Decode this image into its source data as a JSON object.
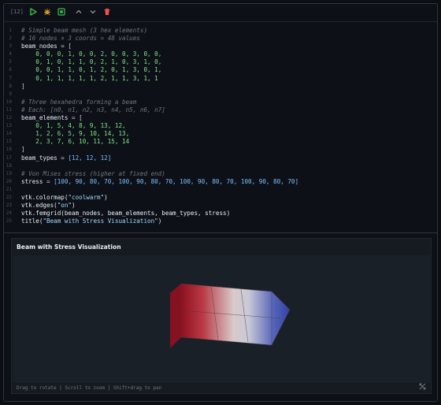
{
  "cell": {
    "execution_count": "[12]",
    "toolbar": {
      "run_icon": "play-icon",
      "debug_icon": "bug-icon",
      "save_icon": "save-icon",
      "move_up_icon": "chevron-up-icon",
      "move_down_icon": "chevron-down-icon",
      "delete_icon": "trash-icon"
    },
    "code_lines": [
      {
        "n": "1",
        "tokens": [
          {
            "t": "comment",
            "v": "# Simple beam mesh (3 hex elements)"
          }
        ]
      },
      {
        "n": "2",
        "tokens": [
          {
            "t": "comment",
            "v": "# 16 nodes × 3 coords = 48 values"
          }
        ]
      },
      {
        "n": "3",
        "tokens": [
          {
            "t": "ident",
            "v": "beam_nodes"
          },
          {
            "t": "op",
            "v": " = ["
          }
        ]
      },
      {
        "n": "4",
        "tokens": [
          {
            "t": "nums",
            "v": "    0, 0, 0, 1, 0, 0, 2, 0, 0, 3, 0, 0,"
          }
        ]
      },
      {
        "n": "5",
        "tokens": [
          {
            "t": "nums",
            "v": "    0, 1, 0, 1, 1, 0, 2, 1, 0, 3, 1, 0,"
          }
        ]
      },
      {
        "n": "6",
        "tokens": [
          {
            "t": "nums",
            "v": "    0, 0, 1, 1, 0, 1, 2, 0, 1, 3, 0, 1,"
          }
        ]
      },
      {
        "n": "7",
        "tokens": [
          {
            "t": "nums",
            "v": "    0, 1, 1, 1, 1, 1, 2, 1, 1, 3, 1, 1"
          }
        ]
      },
      {
        "n": "8",
        "tokens": [
          {
            "t": "op",
            "v": "]"
          }
        ]
      },
      {
        "n": "9",
        "tokens": []
      },
      {
        "n": "10",
        "tokens": [
          {
            "t": "comment",
            "v": "# Three hexahedra forming a beam"
          }
        ]
      },
      {
        "n": "11",
        "tokens": [
          {
            "t": "comment",
            "v": "# Each: [n0, n1, n2, n3, n4, n5, n6, n7]"
          }
        ]
      },
      {
        "n": "12",
        "tokens": [
          {
            "t": "ident",
            "v": "beam_elements"
          },
          {
            "t": "op",
            "v": " = ["
          }
        ]
      },
      {
        "n": "13",
        "tokens": [
          {
            "t": "nums",
            "v": "    0, 1, 5, 4, 8, 9, 13, 12,"
          }
        ]
      },
      {
        "n": "14",
        "tokens": [
          {
            "t": "nums",
            "v": "    1, 2, 6, 5, 9, 10, 14, 13,"
          }
        ]
      },
      {
        "n": "15",
        "tokens": [
          {
            "t": "nums",
            "v": "    2, 3, 7, 6, 10, 11, 15, 14"
          }
        ]
      },
      {
        "n": "16",
        "tokens": [
          {
            "t": "op",
            "v": "]"
          }
        ]
      },
      {
        "n": "17",
        "tokens": [
          {
            "t": "ident",
            "v": "beam_types"
          },
          {
            "t": "op",
            "v": " = "
          },
          {
            "t": "num",
            "v": "[12, 12, 12]"
          }
        ]
      },
      {
        "n": "18",
        "tokens": []
      },
      {
        "n": "19",
        "tokens": [
          {
            "t": "comment",
            "v": "# Von Mises stress (higher at fixed end)"
          }
        ]
      },
      {
        "n": "20",
        "tokens": [
          {
            "t": "ident",
            "v": "stress"
          },
          {
            "t": "op",
            "v": " = "
          },
          {
            "t": "num",
            "v": "[100, 90, 80, 70, 100, 90, 80, 70, 100, 90, 80, 70, 100, 90, 80, 70]"
          }
        ]
      },
      {
        "n": "21",
        "tokens": []
      },
      {
        "n": "22",
        "tokens": [
          {
            "t": "fn",
            "v": "vtk.colormap("
          },
          {
            "t": "str",
            "v": "\"coolwarm\""
          },
          {
            "t": "fn",
            "v": ")"
          }
        ]
      },
      {
        "n": "23",
        "tokens": [
          {
            "t": "fn",
            "v": "vtk.edges("
          },
          {
            "t": "str",
            "v": "\"on\""
          },
          {
            "t": "fn",
            "v": ")"
          }
        ]
      },
      {
        "n": "24",
        "tokens": [
          {
            "t": "fn",
            "v": "vtk.femgrid(beam_nodes, beam_elements, beam_types, stress)"
          }
        ]
      },
      {
        "n": "25",
        "tokens": [
          {
            "t": "fn",
            "v": "title("
          },
          {
            "t": "str",
            "v": "\"Beam with Stress Visualization\""
          },
          {
            "t": "fn",
            "v": ")"
          }
        ]
      }
    ]
  },
  "output": {
    "plot_title": "Beam with Stress Visualization",
    "hint": "Drag to rotate | Scroll to zoom | Shift+drag to pan",
    "reset_icon": "expand-icon",
    "colormap": {
      "hot": "#b2182b",
      "mid": "#dddddd",
      "cold": "#3b4cc0"
    }
  },
  "colors": {
    "run": "#3fb950",
    "debug": "#d29922",
    "save": "#3fb950",
    "arrows": "#8b949e",
    "delete": "#f85149"
  }
}
